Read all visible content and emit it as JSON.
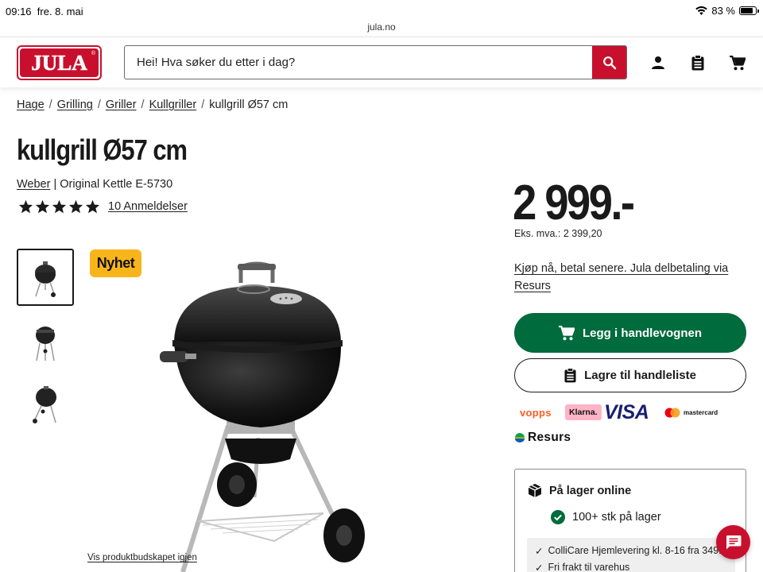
{
  "status": {
    "time": "09:16",
    "date": "fre. 8. mai",
    "battery": "83 %",
    "battery_level": 0.83
  },
  "browser": {
    "url": "jula.no"
  },
  "header": {
    "logo_text": "JULA",
    "logo_reg": "®",
    "search_placeholder": "Hei! Hva søker du etter i dag?",
    "icons": [
      "search-icon",
      "account-icon",
      "shopping-list-icon",
      "cart-icon"
    ],
    "brand_color": "#c8102e"
  },
  "breadcrumb": {
    "items": [
      "Hage",
      "Grilling",
      "Griller",
      "Kullgriller"
    ],
    "current": "kullgrill Ø57 cm"
  },
  "product": {
    "title": "kullgrill Ø57 cm",
    "brand": "Weber",
    "separator": " | ",
    "model": "Original Kettle E-5730",
    "rating": 5,
    "reviews_label": "10 Anmeldelser",
    "badge": "Nyhet",
    "price": "2 999.-",
    "ex_vat": "Eks. mva.: 2 399,20",
    "installment_link": "Kjøp nå, betal senere. Jula delbetaling via Resurs",
    "add_to_cart": "Legg i handlevognen",
    "save_to_list": "Lagre til handleliste",
    "show_bundle_link": "Vis produktbudskapet igjen"
  },
  "payment_logos": {
    "vipps": "vᴏpps",
    "klarna": "Klarna.",
    "visa": "VISA",
    "mastercard": "mastercard",
    "resurs": "Resurs"
  },
  "stock": {
    "title": "På lager online",
    "qty": "100+ stk på lager",
    "delivery": [
      "ColliCare Hjemlevering kl. 8-16 fra 349.",
      "Fri frakt til varehus"
    ]
  },
  "colors": {
    "primary_green": "#006b3c",
    "badge_yellow": "#f8b51b"
  }
}
